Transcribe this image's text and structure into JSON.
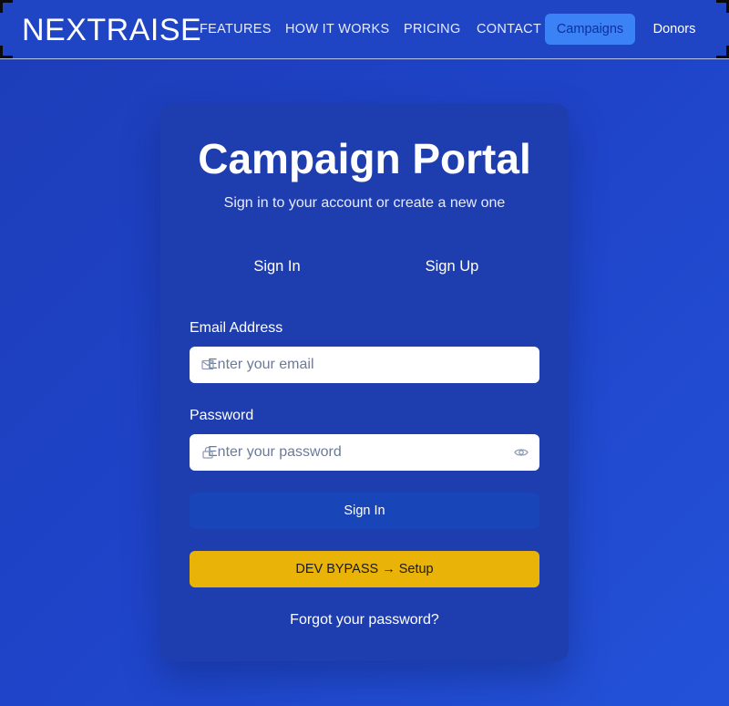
{
  "header": {
    "logo": "NEXTRAISE",
    "nav": {
      "features": "FEATURES",
      "how_it_works": "HOW IT WORKS",
      "pricing": "PRICING",
      "contact": "CONTACT",
      "campaigns": "Campaigns",
      "donors": "Donors"
    }
  },
  "card": {
    "title": "Campaign Portal",
    "subtitle": "Sign in to your account or create a new one",
    "tabs": {
      "sign_in": "Sign In",
      "sign_up": "Sign Up"
    },
    "email": {
      "label": "Email Address",
      "placeholder": "Enter your email",
      "value": "",
      "icon": "mail-icon"
    },
    "password": {
      "label": "Password",
      "placeholder": "Enter your password",
      "value": "",
      "icon": "lock-icon",
      "toggle_icon": "eye-icon"
    },
    "submit_label": "Sign In",
    "dev_bypass_label": "DEV BYPASS → Setup",
    "forgot_label": "Forgot your password?"
  },
  "colors": {
    "background": "#1f44c9",
    "card": "#1e3eb0",
    "primary_button": "#1845b7",
    "dev_button": "#eab308",
    "active_nav": "#3b82f6"
  }
}
